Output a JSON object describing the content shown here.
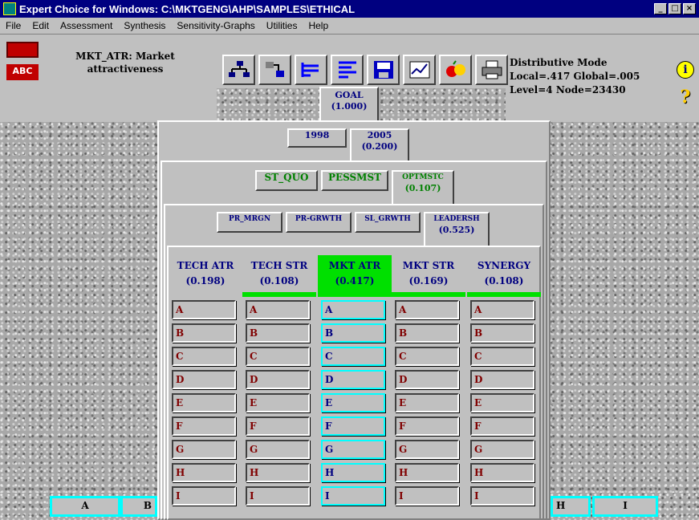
{
  "window": {
    "title": "Expert Choice for Windows: C:\\MKTGENG\\AHP\\SAMPLES\\ETHICAL",
    "min_glyph": "_",
    "max_glyph": "□",
    "close_glyph": "×"
  },
  "menu": [
    "File",
    "Edit",
    "Assessment",
    "Synthesis",
    "Sensitivity-Graphs",
    "Utilities",
    "Help"
  ],
  "node": {
    "name_line1": "MKT_ATR: Market",
    "name_line2": "attractiveness",
    "abc_label": "ABC"
  },
  "toolbar": [
    "hierarchy-icon",
    "network-icon",
    "tree-icon",
    "list-icon",
    "save-icon",
    "graph-icon",
    "fruit-icon",
    "print-icon"
  ],
  "mode": {
    "line1": "Distributive Mode",
    "line2": "Local=.417 Global=.005",
    "line3": "Level=4  Node=23430",
    "info_glyph": "i",
    "help_glyph": "?"
  },
  "goal": {
    "label": "GOAL",
    "value": "(1.000)"
  },
  "years": [
    {
      "label": "1998",
      "value": ""
    },
    {
      "label": "2005",
      "value": "(0.200)"
    }
  ],
  "scenarios": [
    {
      "label": "ST_QUO",
      "value": ""
    },
    {
      "label": "PESSMST",
      "value": ""
    },
    {
      "label": "OPTMSTC",
      "value": "(0.107)"
    }
  ],
  "strategies": [
    {
      "label": "PR_MRGN",
      "value": ""
    },
    {
      "label": "PR-GRWTH",
      "value": ""
    },
    {
      "label": "SL_GRWTH",
      "value": ""
    },
    {
      "label": "LEADERSH",
      "value": "(0.525)"
    }
  ],
  "criteria": [
    {
      "label": "TECH ATR",
      "value": "(0.198)",
      "fill": 0.198
    },
    {
      "label": "TECH STR",
      "value": "(0.108)",
      "fill": 0.108
    },
    {
      "label": "MKT ATR",
      "value": "(0.417)",
      "fill": 0.417
    },
    {
      "label": "MKT STR",
      "value": "(0.169)",
      "fill": 0.169
    },
    {
      "label": "SYNERGY",
      "value": "(0.108)",
      "fill": 0.108
    }
  ],
  "alternatives": [
    "A",
    "B",
    "C",
    "D",
    "E",
    "F",
    "G",
    "H",
    "I"
  ],
  "bottom_row": [
    "A",
    "B",
    "H",
    "I"
  ]
}
